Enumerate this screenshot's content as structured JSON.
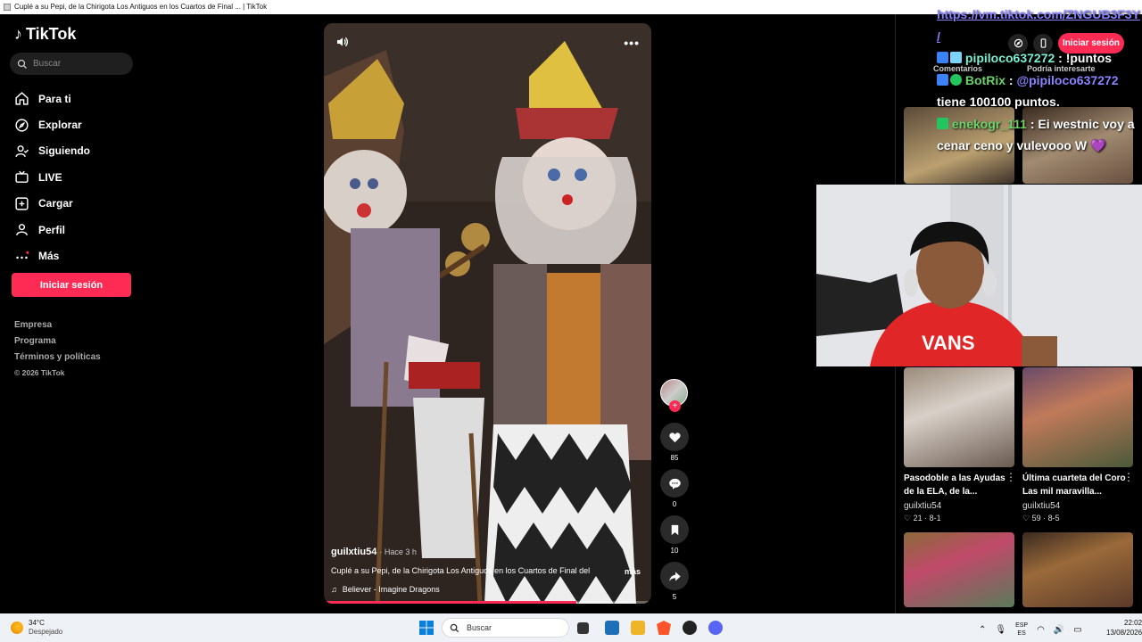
{
  "window": {
    "title": "Cuplé a su Pepi, de la Chirigota Los Antiguos en los Cuartos de Final ... | TikTok"
  },
  "sidebar": {
    "logo": "TikTok",
    "search_placeholder": "Buscar",
    "items": [
      {
        "label": "Para ti",
        "icon": "home-icon"
      },
      {
        "label": "Explorar",
        "icon": "compass-icon"
      },
      {
        "label": "Siguiendo",
        "icon": "following-icon"
      },
      {
        "label": "LIVE",
        "icon": "live-icon"
      },
      {
        "label": "Cargar",
        "icon": "upload-icon"
      },
      {
        "label": "Perfil",
        "icon": "profile-icon"
      },
      {
        "label": "Más",
        "icon": "more-icon"
      }
    ],
    "login_label": "Iniciar sesión",
    "footer": [
      "Empresa",
      "Programa",
      "Términos y políticas"
    ],
    "copyright": "© 2026 TikTok"
  },
  "video": {
    "author": "guilxtiu54",
    "ago": "· Hace 3 h",
    "description": "Cuplé a su Pepi, de la Chirigota Los Antiguos en los Cuartos de Final del",
    "more_label": "más",
    "music": "Believer - Imagine Dragons",
    "progress": 0.77
  },
  "actions": {
    "likes": "85",
    "comments": "0",
    "saves": "10",
    "shares": "5"
  },
  "right_panel": {
    "login_label": "Iniciar sesión",
    "tabs": [
      "Comentarios",
      "Podría interesarte"
    ],
    "thumbs": [
      {
        "title": "Pasodoble a las Ayudas de la ELA, de la...",
        "user": "guilxtiu54",
        "stats": "♡ 21 · 8-1"
      },
      {
        "title": "Última cuarteta del Coro Las mil maravilla...",
        "user": "guilxtiu54",
        "stats": "♡ 59 · 8-5"
      }
    ]
  },
  "chat": {
    "link": "https://vm.tiktok.com/ZNGUB3F3Y",
    "link_tail": "/",
    "msg1_user": "pipiloco637272",
    "msg1_text": " : !puntos",
    "msg2_user": "BotRix",
    "msg2_sep": " : ",
    "msg2_mention": "@pipiloco637272",
    "msg2_text": "tiene 100100 puntos.",
    "msg3_user": "enekogr_111",
    "msg3_text": " : Ei westnic voy a cenar ceno y vulevooo W 💜"
  },
  "taskbar": {
    "temp": "34°C",
    "weather": "Despejado",
    "search_placeholder": "Buscar",
    "lang1": "ESP",
    "lang2": "ES",
    "time": "22:02",
    "date": "13/08/2026"
  }
}
